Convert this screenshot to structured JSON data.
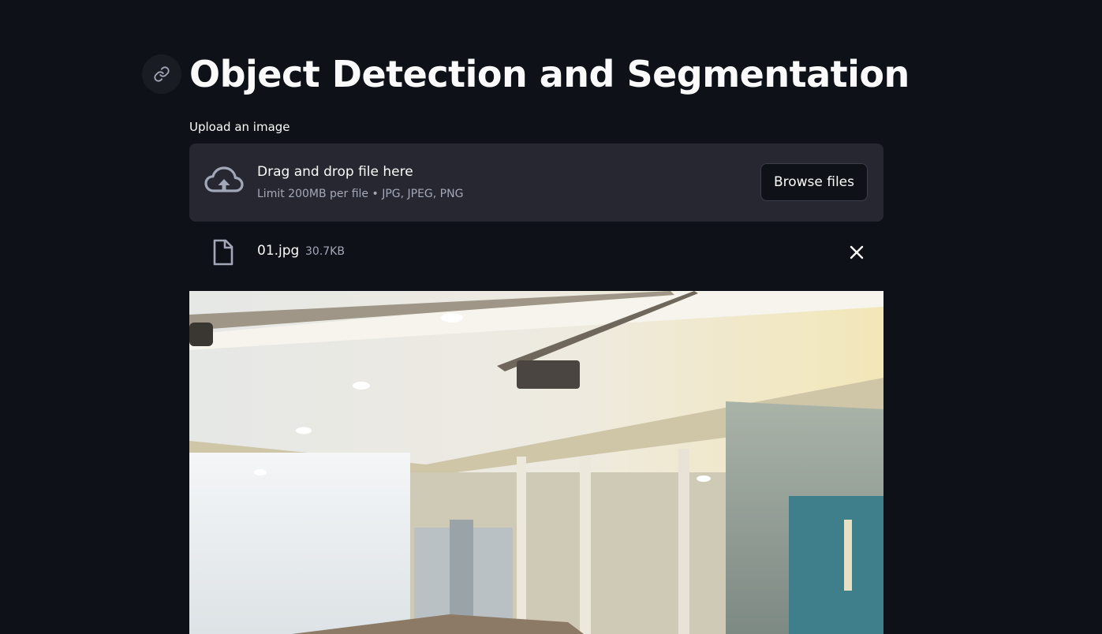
{
  "header": {
    "title": "Object Detection and Segmentation",
    "anchor_icon": "link-icon"
  },
  "uploader": {
    "label": "Upload an image",
    "drop_title": "Drag and drop file here",
    "drop_subtitle": "Limit 200MB per file • JPG, JPEG, PNG",
    "browse_label": "Browse files",
    "upload_icon": "cloud-upload-icon"
  },
  "uploaded_file": {
    "name": "01.jpg",
    "size": "30.7KB",
    "file_icon": "file-icon",
    "remove_icon": "close-icon"
  },
  "preview": {
    "kind": "uploaded-image-preview"
  },
  "colors": {
    "background": "#0e1117",
    "dropzone": "#262730",
    "text": "#fafafa",
    "muted_text": "#a3a8b8"
  }
}
